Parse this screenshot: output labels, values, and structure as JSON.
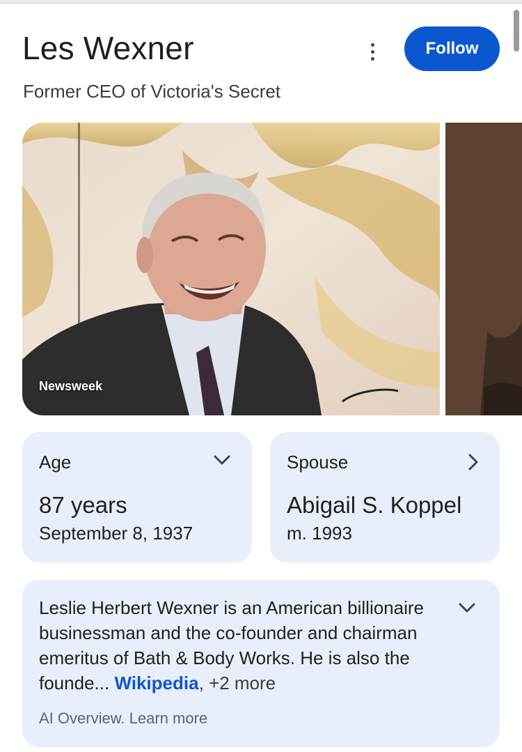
{
  "header": {
    "title": "Les Wexner",
    "subtitle": "Former CEO of Victoria's Secret",
    "follow_label": "Follow",
    "menu_icon": "more-vert-icon"
  },
  "images": {
    "main_source": "Newsweek"
  },
  "facts": {
    "age": {
      "label": "Age",
      "value": "87 years",
      "sub": "September 8, 1937",
      "icon": "chevron-down-icon"
    },
    "spouse": {
      "label": "Spouse",
      "value": "Abigail S. Koppel",
      "sub": "m. 1993",
      "icon": "chevron-right-icon"
    }
  },
  "overview": {
    "text": "Leslie Herbert Wexner is an American billionaire businessman and the co-founder and chairman emeritus of Bath & Body Works. He is also the founde...",
    "source_link": "Wikipedia",
    "more": ", +2 more",
    "footer_label": "AI Overview.",
    "learn_more": "Learn more"
  },
  "colors": {
    "accent": "#0b57d0",
    "card_bg": "#e9eefb"
  }
}
